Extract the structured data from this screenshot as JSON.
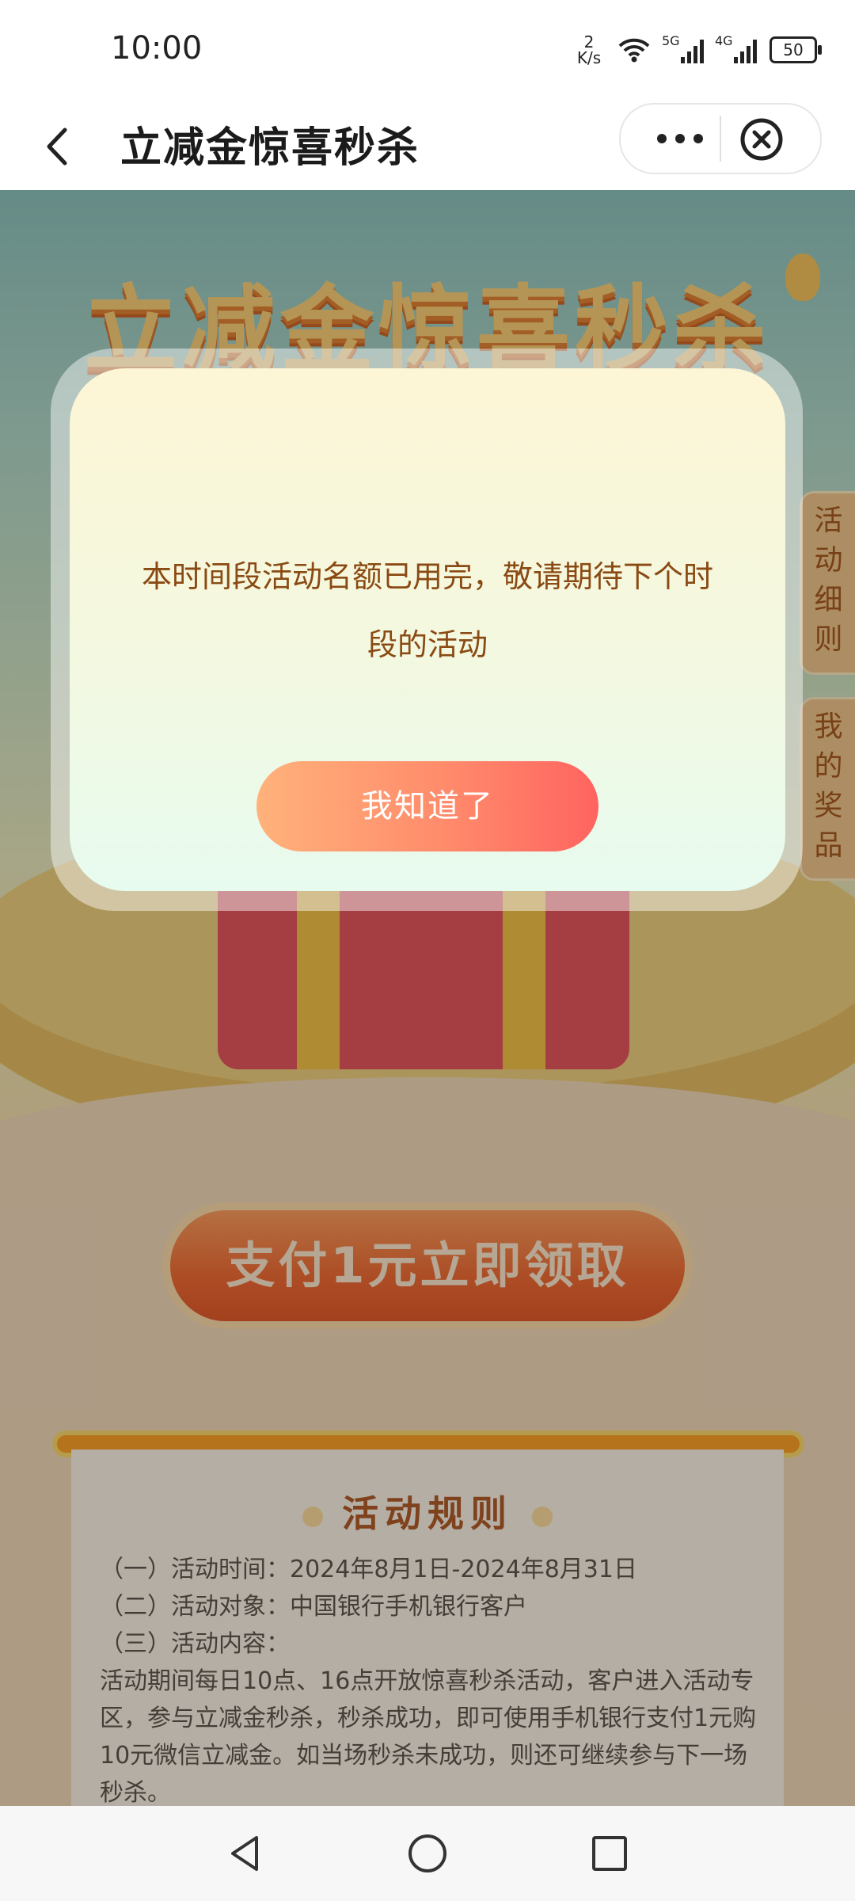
{
  "status_bar": {
    "time": "10:00",
    "net_speed_value": "2",
    "net_speed_unit": "K/s",
    "signal1_label": "5G",
    "signal2_label": "4G",
    "battery": "50"
  },
  "titlebar": {
    "title": "立减金惊喜秒杀"
  },
  "hero": {
    "banner_title": "立减金惊喜秒杀"
  },
  "side_tabs": {
    "rules": "活动细则",
    "prizes": "我的奖品"
  },
  "pay_button": "支付1元立即领取",
  "rules": {
    "heading": "活动规则",
    "lines": [
      "（一）活动时间：2024年8月1日-2024年8月31日",
      "（二）活动对象：中国银行手机银行客户",
      "（三）活动内容：",
      "活动期间每日10点、16点开放惊喜秒杀活动，客户进入活动专区，参与立减金秒杀，秒杀成功，即可使用手机银行支付1元购10元微信立减金。如当场秒杀未成功，则还可继续参与下一场秒杀。"
    ]
  },
  "modal": {
    "message": "本时间段活动名额已用完，敬请期待下个时段的活动",
    "button": "我知道了"
  },
  "colors": {
    "accent": "#f2612b",
    "modal_text": "#8a4a13",
    "tab_text": "#9c4d12"
  },
  "icons": [
    "back-icon",
    "more-icon",
    "close-circle-icon",
    "wifi-icon",
    "nav-back-icon",
    "nav-home-icon",
    "nav-recents-icon"
  ]
}
